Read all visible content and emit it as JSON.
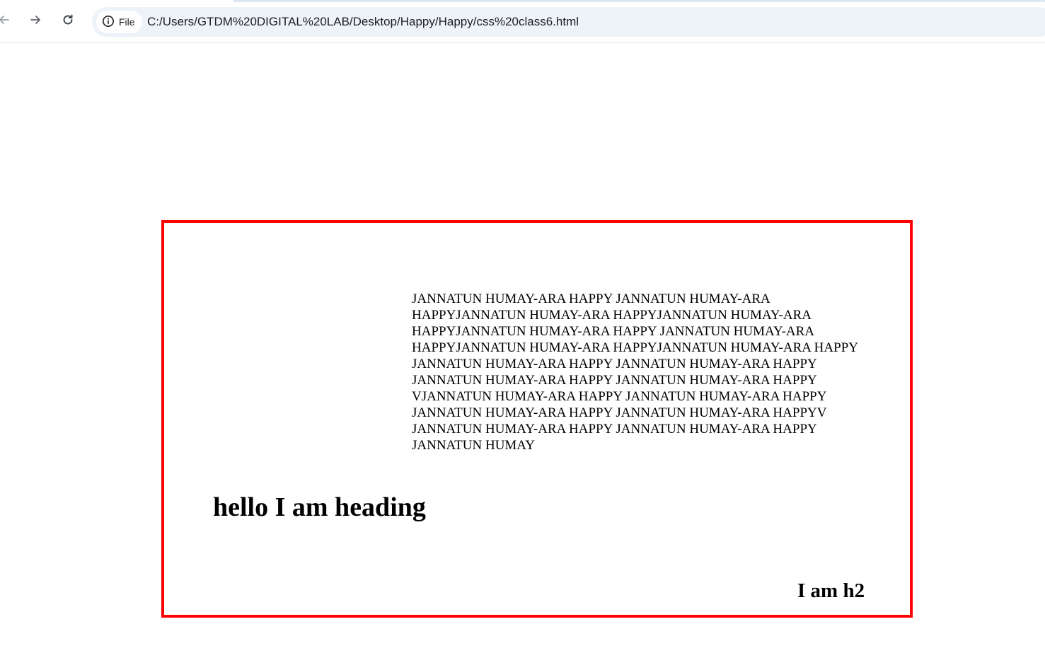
{
  "browser": {
    "back_icon": "arrow-left-icon",
    "forward_icon": "arrow-right-icon",
    "reload_icon": "reload-icon",
    "site_info_icon": "info-circle-icon",
    "scheme_label": "File",
    "url": "C:/Users/GTDM%20DIGITAL%20LAB/Desktop/Happy/Happy/css%20class6.html"
  },
  "page": {
    "border_color": "#ff0000",
    "paragraph_lines": [
      "JANNATUN HUMAY-ARA HAPPY JANNATUN HUMAY-ARA",
      "HAPPYJANNATUN HUMAY-ARA HAPPYJANNATUN HUMAY-ARA",
      "HAPPYJANNATUN HUMAY-ARA HAPPY JANNATUN HUMAY-ARA",
      "HAPPYJANNATUN HUMAY-ARA HAPPYJANNATUN HUMAY-ARA HAPPY",
      "JANNATUN HUMAY-ARA HAPPY JANNATUN HUMAY-ARA HAPPY",
      "JANNATUN HUMAY-ARA HAPPY JANNATUN HUMAY-ARA HAPPY",
      "VJANNATUN HUMAY-ARA HAPPY JANNATUN HUMAY-ARA HAPPY",
      "JANNATUN HUMAY-ARA HAPPY JANNATUN HUMAY-ARA HAPPYV",
      "JANNATUN HUMAY-ARA HAPPY JANNATUN HUMAY-ARA HAPPY",
      "JANNATUN HUMAY"
    ],
    "heading1": "hello I am heading",
    "heading2": "I am h2"
  }
}
